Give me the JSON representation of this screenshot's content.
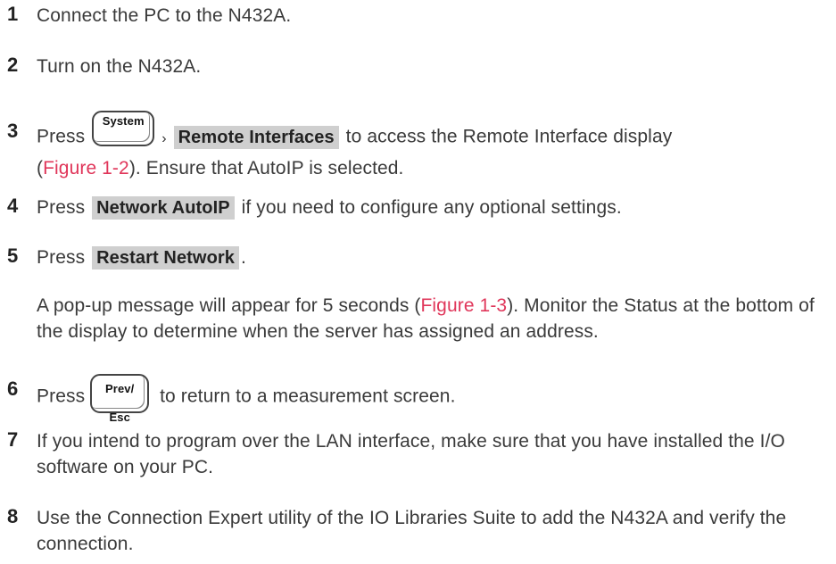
{
  "steps": [
    {
      "num": "1",
      "text": "Connect the PC to the N432A."
    },
    {
      "num": "2",
      "text": "Turn on the N432A."
    },
    {
      "num": "3",
      "prefix": "Press",
      "hard_key": "System",
      "separator": "›",
      "softkey": "Remote Interfaces",
      "middle": "to access the Remote Interface display",
      "link": "Figure 1-2",
      "suffix": "). Ensure that AutoIP is selected."
    },
    {
      "num": "4",
      "prefix": "Press",
      "softkey": "Network AutoIP",
      "suffix": "if you need to configure any optional settings."
    },
    {
      "num": "5",
      "prefix": "Press",
      "softkey": "Restart Network",
      "suffix": ".",
      "note_prefix": "A pop-up message will appear for 5 seconds (",
      "note_link": "Figure 1-3",
      "note_suffix": "). Monitor the Status at the bottom of the display to determine when the server has assigned an address."
    },
    {
      "num": "6",
      "prefix": "Press",
      "hard_key_line1": "Prev/",
      "hard_key_line2": "Esc",
      "suffix": "to return to a measurement screen."
    },
    {
      "num": "7",
      "text": "If you intend to program over the LAN interface, make sure that you have installed the I/O software on your PC."
    },
    {
      "num": "8",
      "text": "Use the Connection Expert utility of the IO Libraries Suite to add the N432A and verify the connection."
    }
  ]
}
